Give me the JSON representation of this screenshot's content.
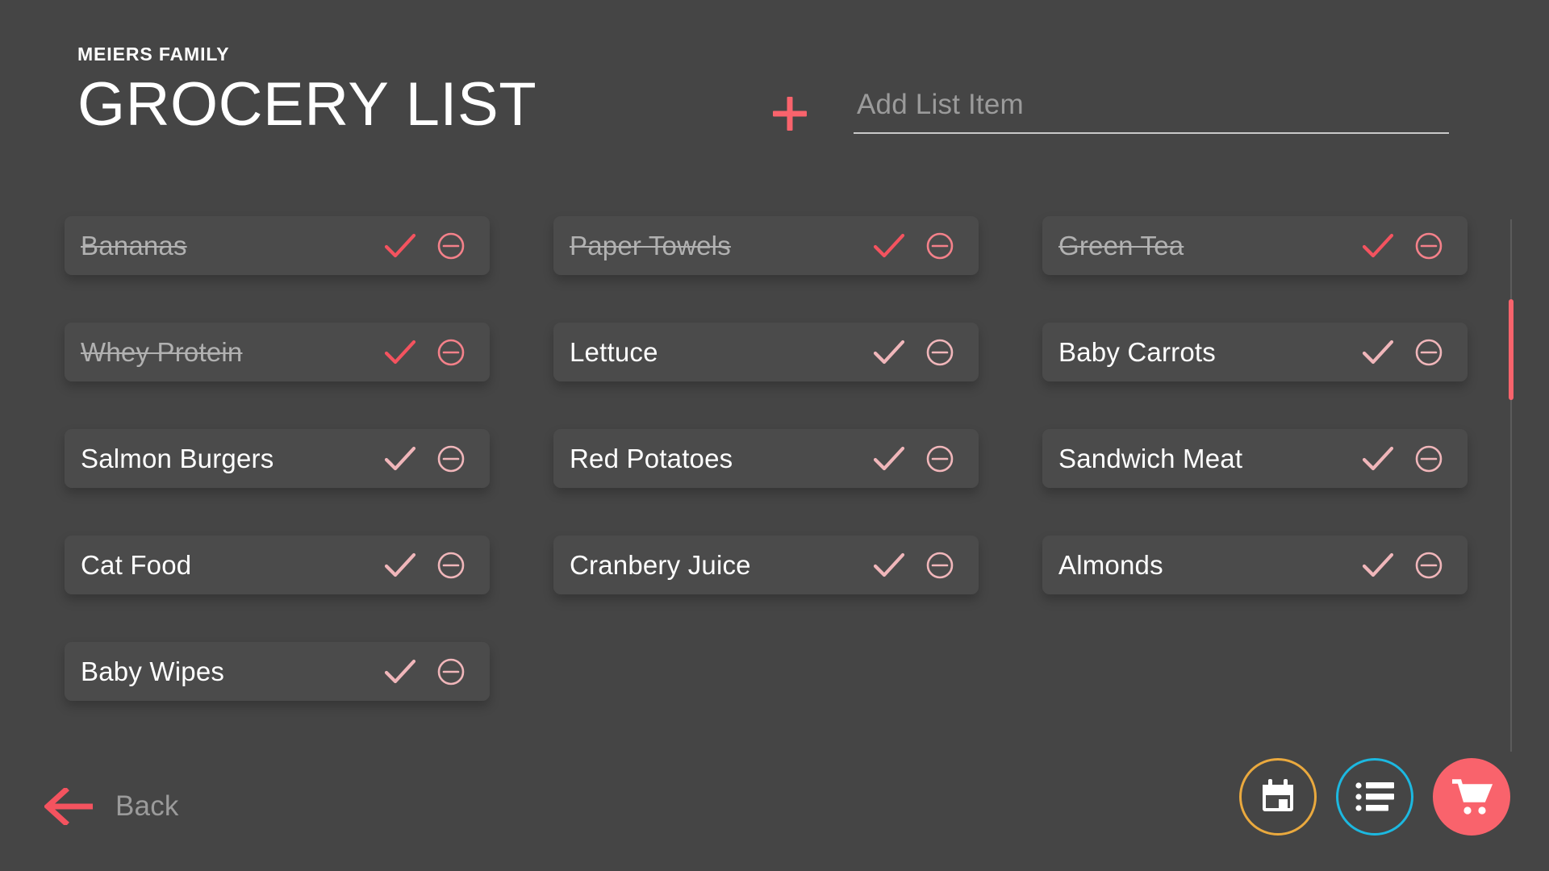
{
  "header": {
    "family_name": "MEIERS FAMILY",
    "page_title": "GROCERY LIST"
  },
  "add_item": {
    "plus_icon": "plus-icon",
    "placeholder": "Add List Item",
    "value": ""
  },
  "colors": {
    "background": "#454545",
    "card": "#4b4b4b",
    "accent_pink": "#f9636c",
    "accent_pink_strong": "#f4535f",
    "accent_pink_pale": "#f0b6ba",
    "text_primary": "#ffffff",
    "text_muted": "#9b9b9b",
    "text_struck": "#b1b1b1",
    "calendar_outline": "#eaa93e",
    "list_outline": "#1cb8e0",
    "scroll_track": "#5c5c5c"
  },
  "list": {
    "check_icon": "check-icon",
    "remove_icon": "minus-circle-icon",
    "columns": [
      {
        "items": [
          {
            "label": "Bananas",
            "done": true
          },
          {
            "label": "Whey Protein",
            "done": true
          },
          {
            "label": "Salmon Burgers",
            "done": false
          },
          {
            "label": "Cat Food",
            "done": false
          },
          {
            "label": "Baby Wipes",
            "done": false
          }
        ]
      },
      {
        "items": [
          {
            "label": "Paper Towels",
            "done": true
          },
          {
            "label": "Lettuce",
            "done": false
          },
          {
            "label": "Red Potatoes",
            "done": false
          },
          {
            "label": "Cranbery Juice",
            "done": false
          }
        ]
      },
      {
        "items": [
          {
            "label": "Green Tea",
            "done": true
          },
          {
            "label": "Baby Carrots",
            "done": false
          },
          {
            "label": "Sandwich Meat",
            "done": false
          },
          {
            "label": "Almonds",
            "done": false
          }
        ]
      }
    ]
  },
  "scrollbar": {
    "thumb_top_pct": 15,
    "thumb_height_pct": 19
  },
  "footer": {
    "back_label": "Back",
    "back_icon": "arrow-left-icon",
    "actions": [
      {
        "name": "calendar-fab",
        "icon": "calendar-icon"
      },
      {
        "name": "list-fab",
        "icon": "list-icon"
      },
      {
        "name": "cart-fab",
        "icon": "shopping-cart-icon"
      }
    ]
  }
}
